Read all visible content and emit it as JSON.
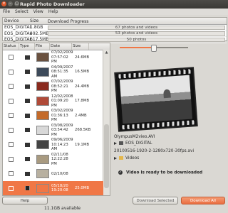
{
  "window": {
    "title": "Rapid Photo Downloader",
    "controls": [
      "×",
      "–",
      "□"
    ]
  },
  "menu": [
    "File",
    "Select",
    "View",
    "Help"
  ],
  "devices": {
    "headers": {
      "device": "Device",
      "size": "Size",
      "progress": "Download Progress"
    },
    "rows": [
      {
        "device": "EOS_DIGITAL",
        "size": "1.8GB",
        "progress": "67 photos and videos"
      },
      {
        "device": "EOS_DIGITAL",
        "size": "492.5MB",
        "progress": "53 photos and videos"
      },
      {
        "device": "EOS_DIGITAL",
        "size": "617.5MB",
        "progress": "50 photos"
      }
    ]
  },
  "files": {
    "headers": {
      "status": "Status",
      "type": "Type",
      "file": "File",
      "date": "Date",
      "size": "Size"
    },
    "rows": [
      {
        "date": "07/02/2009",
        "time": "07:57:02 PM",
        "size": "24.6MB",
        "type": "photo",
        "thumb": "#6a5140",
        "selected": false
      },
      {
        "date": "04/09/2007",
        "time": "08:51:35 AM",
        "size": "16.5MB",
        "type": "photo",
        "thumb": "#3d4a5a",
        "selected": false
      },
      {
        "date": "07/02/2009",
        "time": "08:52:21 PM",
        "size": "24.4MB",
        "type": "photo",
        "thumb": "#8a2a1e",
        "selected": false
      },
      {
        "date": "12/02/2008",
        "time": "01:09:20 PM",
        "size": "17.8MB",
        "type": "photo",
        "thumb": "#b04a38",
        "selected": false
      },
      {
        "date": "03/02/2009",
        "time": "01:36:13 PM",
        "size": "2.4MB",
        "type": "photo",
        "thumb": "#c46a2a",
        "selected": false
      },
      {
        "date": "03/08/2009",
        "time": "03:54:42 PM",
        "size": "268.5KB",
        "type": "photo",
        "thumb": "#d8d8d8",
        "selected": false
      },
      {
        "date": "09/06/2009",
        "time": "10:14:23 AM",
        "size": "19.1MB",
        "type": "photo",
        "thumb": "#444444",
        "selected": false
      },
      {
        "date": "02/11/08",
        "time": "12:22:28 PM",
        "size": "",
        "type": "photo",
        "thumb": "#a89a80",
        "selected": false
      },
      {
        "date": "02/10/08",
        "time": "",
        "size": "",
        "type": "photo",
        "thumb": "#b8b0a0",
        "selected": false
      },
      {
        "date": "05/18/20",
        "time": "19:20:08",
        "size": "25.0MB",
        "type": "video",
        "thumb": "#f07746",
        "selected": true
      }
    ]
  },
  "preview": {
    "filename": "OlympusM2vieo.AVI",
    "device": "EOS_DIGITAL",
    "new_name": "20100516-1920-2-1280x720-30fps.avi",
    "folder": "Videos",
    "status": "Video is ready to be downloaded"
  },
  "buttons": {
    "help": "Help",
    "download_selected": "Download Selected (1)",
    "download_all": "Download All"
  },
  "statusbar": {
    "text": "11.1GB available"
  },
  "zoom": {
    "level": 0.5
  },
  "colors": {
    "accent": "#f07746"
  }
}
